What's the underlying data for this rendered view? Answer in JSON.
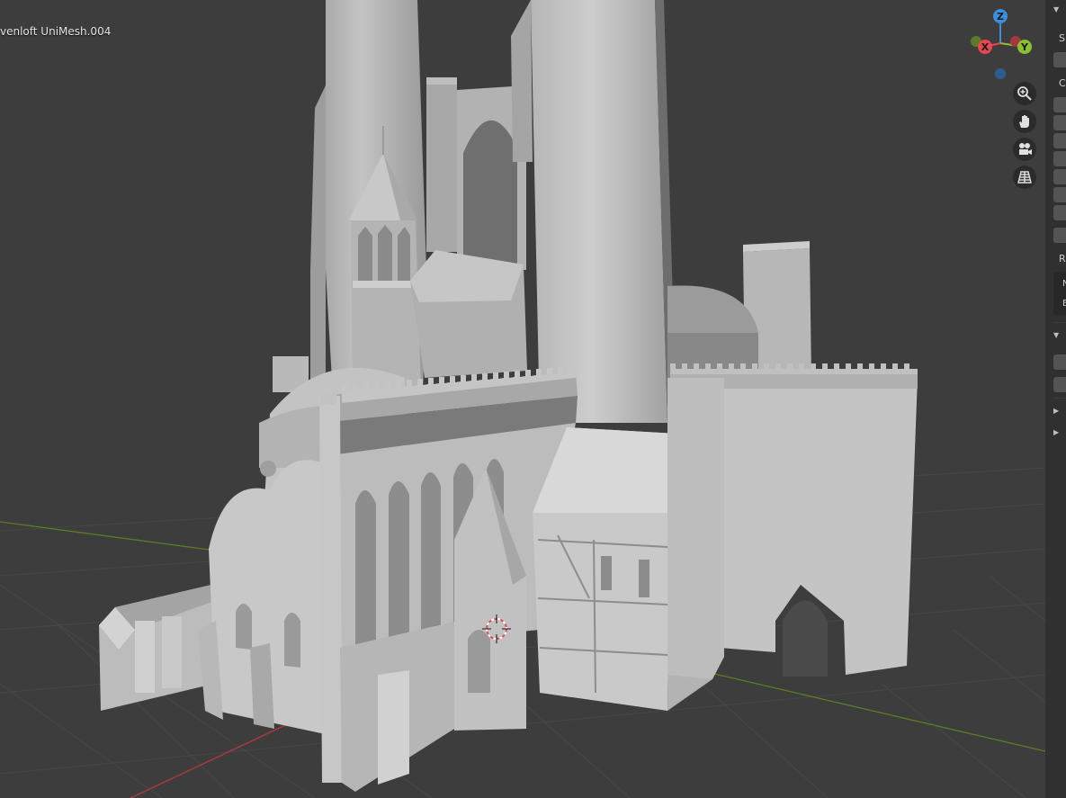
{
  "viewport": {
    "object_label": "venloft UniMesh.004",
    "gizmo": {
      "x": "X",
      "y": "Y",
      "z": "Z"
    },
    "colors": {
      "background": "#3d3d3d",
      "x_axis": "#e7474f",
      "y_axis": "#8ac12c",
      "z_axis": "#3a8fe0"
    },
    "nav_buttons": [
      "zoom-icon",
      "pan-hand-icon",
      "camera-icon",
      "grid-perspective-icon"
    ]
  },
  "side_panel": {
    "section_letters": [
      "S",
      "C",
      "R"
    ],
    "text_fragments": [
      "N",
      "E"
    ]
  }
}
